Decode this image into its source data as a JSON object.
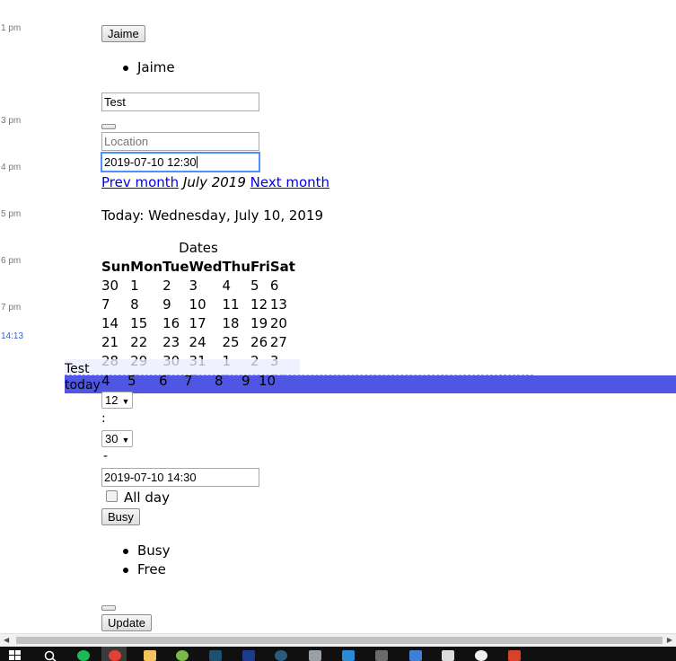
{
  "timeline": {
    "hours": [
      "1 pm",
      "3 pm",
      "4 pm",
      "5 pm",
      "6 pm",
      "7 pm"
    ],
    "now_marker": "14:13"
  },
  "attendee": {
    "button_label": "Jaime",
    "list": [
      "Jaime"
    ]
  },
  "title_field": {
    "value": "Test"
  },
  "location_field": {
    "placeholder": "Location",
    "value": ""
  },
  "start_field": {
    "value": "2019-07-10 12:30"
  },
  "calendar": {
    "prev_label": "Prev month",
    "current_month": "July 2019",
    "next_label": "Next month",
    "today_text": "Today: Wednesday, July 10, 2019",
    "caption": "Dates",
    "weekdays": [
      "Sun",
      "Mon",
      "Tue",
      "Wed",
      "Thu",
      "Fri",
      "Sat"
    ],
    "weeks": [
      [
        "30",
        "1",
        "2",
        "3",
        "4",
        "5",
        "6"
      ],
      [
        "7",
        "8",
        "9",
        "10",
        "11",
        "12",
        "13"
      ],
      [
        "14",
        "15",
        "16",
        "17",
        "18",
        "19",
        "20"
      ],
      [
        "21",
        "22",
        "23",
        "24",
        "25",
        "26",
        "27"
      ],
      [
        "28",
        "29",
        "30",
        "31",
        "1",
        "2",
        "3"
      ],
      [
        "4",
        "5",
        "6",
        "7",
        "8",
        "9",
        "10"
      ]
    ]
  },
  "event_overlay": {
    "title": "Test",
    "label": "today"
  },
  "time_select": {
    "hour": "12",
    "separator": ":",
    "minute": "30",
    "dash": "-"
  },
  "end_field": {
    "value": "2019-07-10 14:30"
  },
  "all_day": {
    "label": "All day",
    "checked": false
  },
  "status": {
    "button_label": "Busy",
    "options": [
      "Busy",
      "Free"
    ]
  },
  "update_button": "Update",
  "colors": {
    "event_band": "#4f56e3",
    "link": "#0000ee",
    "now_marker": "#3b5bdb"
  },
  "taskbar_icons": [
    "windows-icon",
    "search-icon",
    "spotify-icon",
    "chrome-icon",
    "folder-icon",
    "torrent-icon",
    "app-icon",
    "photoshop-icon",
    "app-icon",
    "box-icon",
    "vscode-icon",
    "app-icon",
    "app-icon",
    "app-icon",
    "app-icon",
    "app-icon"
  ]
}
